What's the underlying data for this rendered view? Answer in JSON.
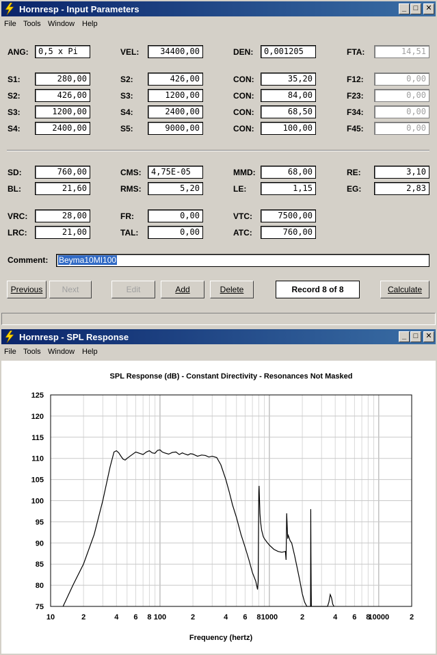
{
  "input_window": {
    "title": "Hornresp - Input Parameters",
    "menu": [
      "File",
      "Tools",
      "Window",
      "Help"
    ],
    "controls": {
      "minimize": "_",
      "maximize": "□",
      "close": "✕"
    },
    "fields": {
      "ang": {
        "label": "ANG:",
        "value": "0,5 x Pi"
      },
      "vel": {
        "label": "VEL:",
        "value": "34400,00"
      },
      "den": {
        "label": "DEN:",
        "value": "0,001205"
      },
      "fta": {
        "label": "FTA:",
        "value": "14,51"
      },
      "s1a": {
        "label": "S1:",
        "value": "280,00"
      },
      "s2a": {
        "label": "S2:",
        "value": "426,00"
      },
      "s3a": {
        "label": "S3:",
        "value": "1200,00"
      },
      "s4a": {
        "label": "S4:",
        "value": "2400,00"
      },
      "s2b": {
        "label": "S2:",
        "value": "426,00"
      },
      "s3b": {
        "label": "S3:",
        "value": "1200,00"
      },
      "s4b": {
        "label": "S4:",
        "value": "2400,00"
      },
      "s5b": {
        "label": "S5:",
        "value": "9000,00"
      },
      "con1": {
        "label": "CON:",
        "value": "35,20"
      },
      "con2": {
        "label": "CON:",
        "value": "84,00"
      },
      "con3": {
        "label": "CON:",
        "value": "68,50"
      },
      "con4": {
        "label": "CON:",
        "value": "100,00"
      },
      "f12": {
        "label": "F12:",
        "value": "0,00"
      },
      "f23": {
        "label": "F23:",
        "value": "0,00"
      },
      "f34": {
        "label": "F34:",
        "value": "0,00"
      },
      "f45": {
        "label": "F45:",
        "value": "0,00"
      },
      "sd": {
        "label": "SD:",
        "value": "760,00"
      },
      "bl": {
        "label": "BL:",
        "value": "21,60"
      },
      "cms": {
        "label": "CMS:",
        "value": "4,75E-05"
      },
      "rms": {
        "label": "RMS:",
        "value": "5,20"
      },
      "mmd": {
        "label": "MMD:",
        "value": "68,00"
      },
      "le": {
        "label": "LE:",
        "value": "1,15"
      },
      "re": {
        "label": "RE:",
        "value": "3,10"
      },
      "eg": {
        "label": "EG:",
        "value": "2,83"
      },
      "vrc": {
        "label": "VRC:",
        "value": "28,00"
      },
      "lrc": {
        "label": "LRC:",
        "value": "21,00"
      },
      "fr": {
        "label": "FR:",
        "value": "0,00"
      },
      "tal": {
        "label": "TAL:",
        "value": "0,00"
      },
      "vtc": {
        "label": "VTC:",
        "value": "7500,00"
      },
      "atc": {
        "label": "ATC:",
        "value": "760,00"
      }
    },
    "comment": {
      "label": "Comment:",
      "value": "Beyma10MI100"
    },
    "buttons": {
      "previous": "Previous",
      "next": "Next",
      "edit": "Edit",
      "add": "Add",
      "delete": "Delete",
      "calculate": "Calculate"
    },
    "record": "Record 8 of 8"
  },
  "spl_window": {
    "title": "Hornresp - SPL Response",
    "menu": [
      "File",
      "Tools",
      "Window",
      "Help"
    ],
    "controls": {
      "minimize": "_",
      "maximize": "□",
      "close": "✕"
    }
  },
  "chart_data": {
    "type": "line",
    "title": "SPL Response (dB) - Constant Directivity - Resonances Not Masked",
    "xlabel": "Frequency (hertz)",
    "ylabel": "",
    "xscale": "log",
    "xlim": [
      10,
      20000
    ],
    "ylim": [
      75,
      125
    ],
    "yticks": [
      75,
      80,
      85,
      90,
      95,
      100,
      105,
      110,
      115,
      120,
      125
    ],
    "xtick_labels": [
      {
        "x": 10,
        "label": "10"
      },
      {
        "x": 20,
        "label": "2"
      },
      {
        "x": 40,
        "label": "4"
      },
      {
        "x": 60,
        "label": "6"
      },
      {
        "x": 80,
        "label": "8"
      },
      {
        "x": 100,
        "label": "100"
      },
      {
        "x": 200,
        "label": "2"
      },
      {
        "x": 400,
        "label": "4"
      },
      {
        "x": 600,
        "label": "6"
      },
      {
        "x": 800,
        "label": "8"
      },
      {
        "x": 1000,
        "label": "1000"
      },
      {
        "x": 2000,
        "label": "2"
      },
      {
        "x": 4000,
        "label": "4"
      },
      {
        "x": 6000,
        "label": "6"
      },
      {
        "x": 8000,
        "label": "8"
      },
      {
        "x": 10000,
        "label": "10000"
      },
      {
        "x": 20000,
        "label": "2"
      }
    ],
    "grid": true,
    "line_color": "#000000",
    "series": [
      {
        "x": [
          13,
          16,
          20,
          25,
          30,
          35,
          38,
          40,
          42,
          44,
          46,
          48,
          50,
          55,
          60,
          65,
          70,
          75,
          80,
          85,
          90,
          95,
          100,
          105,
          110,
          120,
          130,
          140,
          150,
          160,
          170,
          180,
          190,
          200,
          220,
          240,
          260,
          280,
          300,
          330,
          360,
          400,
          430,
          460,
          500,
          550,
          600,
          650,
          700,
          750,
          780,
          790,
          800,
          805,
          810,
          815,
          820,
          830,
          850,
          880,
          900,
          950,
          1000,
          1100,
          1200,
          1300,
          1400,
          1420,
          1440,
          1460,
          1470,
          1480,
          1500,
          1550,
          1600,
          1700,
          1800,
          1900,
          2000,
          2100,
          2200,
          2300,
          2380,
          2390,
          2400,
          2410,
          2420,
          2500,
          2600,
          2700,
          2800,
          2900,
          3000,
          3200,
          3400,
          3500,
          3600,
          3700,
          3800,
          3900
        ],
        "y": [
          75,
          80,
          85,
          92,
          100,
          108,
          111.5,
          111.8,
          111.3,
          110.5,
          109.8,
          109.6,
          110,
          110.8,
          111.5,
          111.2,
          110.9,
          111.5,
          111.8,
          111.3,
          111.2,
          111.9,
          112,
          111.5,
          111.3,
          111,
          111.4,
          111.5,
          110.9,
          111.3,
          111,
          110.8,
          111.1,
          111,
          110.5,
          110.8,
          110.7,
          110.3,
          110.5,
          110.2,
          108.5,
          105,
          102,
          99,
          96,
          92,
          89,
          86,
          83,
          81,
          79,
          81,
          102,
          103.5,
          101,
          99,
          97,
          95,
          93,
          91.5,
          91,
          90.2,
          89.5,
          88.5,
          88,
          87.8,
          88,
          86,
          97,
          93,
          91,
          92,
          91.5,
          90.5,
          90,
          87,
          84,
          81,
          78,
          76,
          75,
          75,
          75,
          98,
          87,
          80,
          75,
          75,
          75,
          75,
          75,
          75,
          75,
          75,
          75,
          76,
          77.8,
          77,
          75.5,
          75
        ]
      }
    ]
  }
}
